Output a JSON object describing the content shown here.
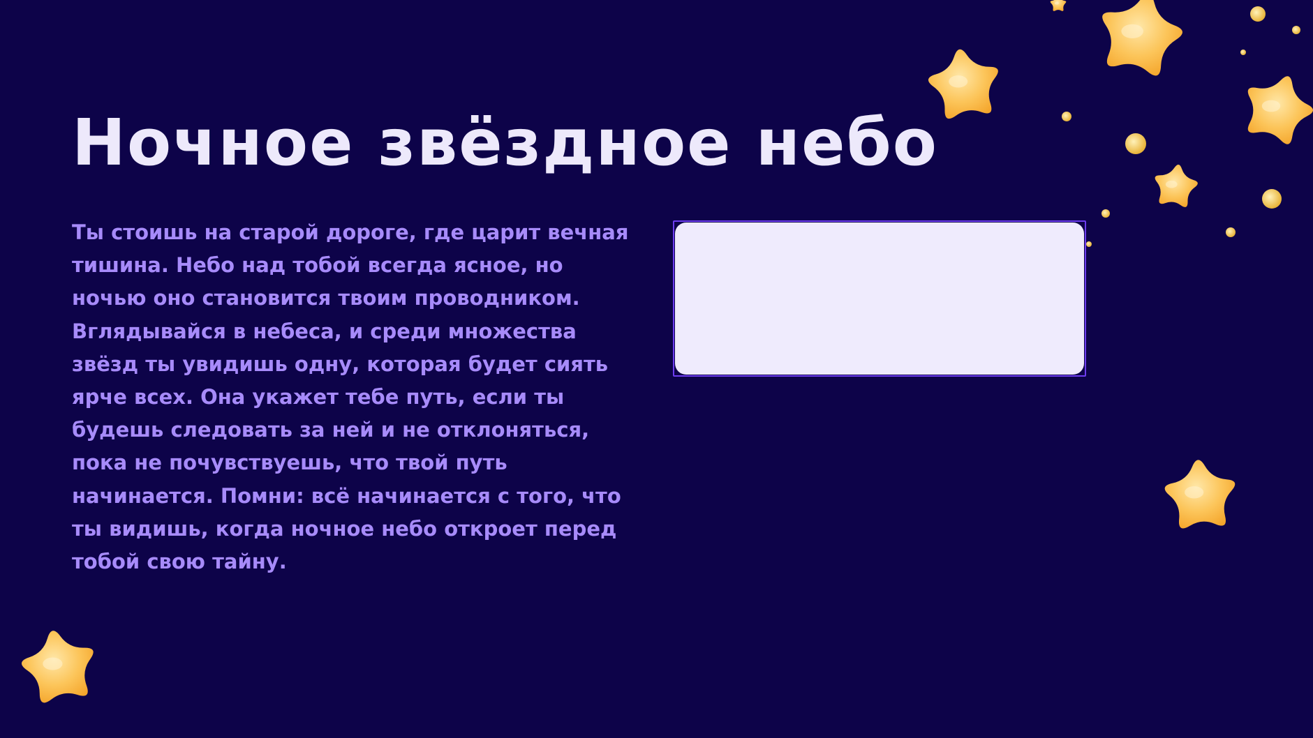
{
  "slide": {
    "title": "Ночное звёздное небо",
    "body": "Ты стоишь на старой дороге, где царит вечная тишина. Небо над тобой всегда ясное, но ночью оно становится твоим проводником. Вглядывайся в небеса, и среди множества звёзд ты увидишь одну, которая будет сиять ярче всех. Она укажет тебе путь, если ты будешь следовать за ней и не отклоняться, пока не почувствуешь, что твой путь начинается. Помни: всё начинается с того, что ты видишь, когда ночное небо откроет перед тобой свою тайну.",
    "textbox_value": ""
  },
  "colors": {
    "background": "#0d0349",
    "title": "#ede9fb",
    "body": "#a78bfa",
    "textbox_fill": "#efebfd",
    "textbox_border": "#6d3df0",
    "star_fill": "#fbbf3c",
    "star_light": "#ffe3a3"
  },
  "icons": [
    "star-icon",
    "dot-icon"
  ]
}
